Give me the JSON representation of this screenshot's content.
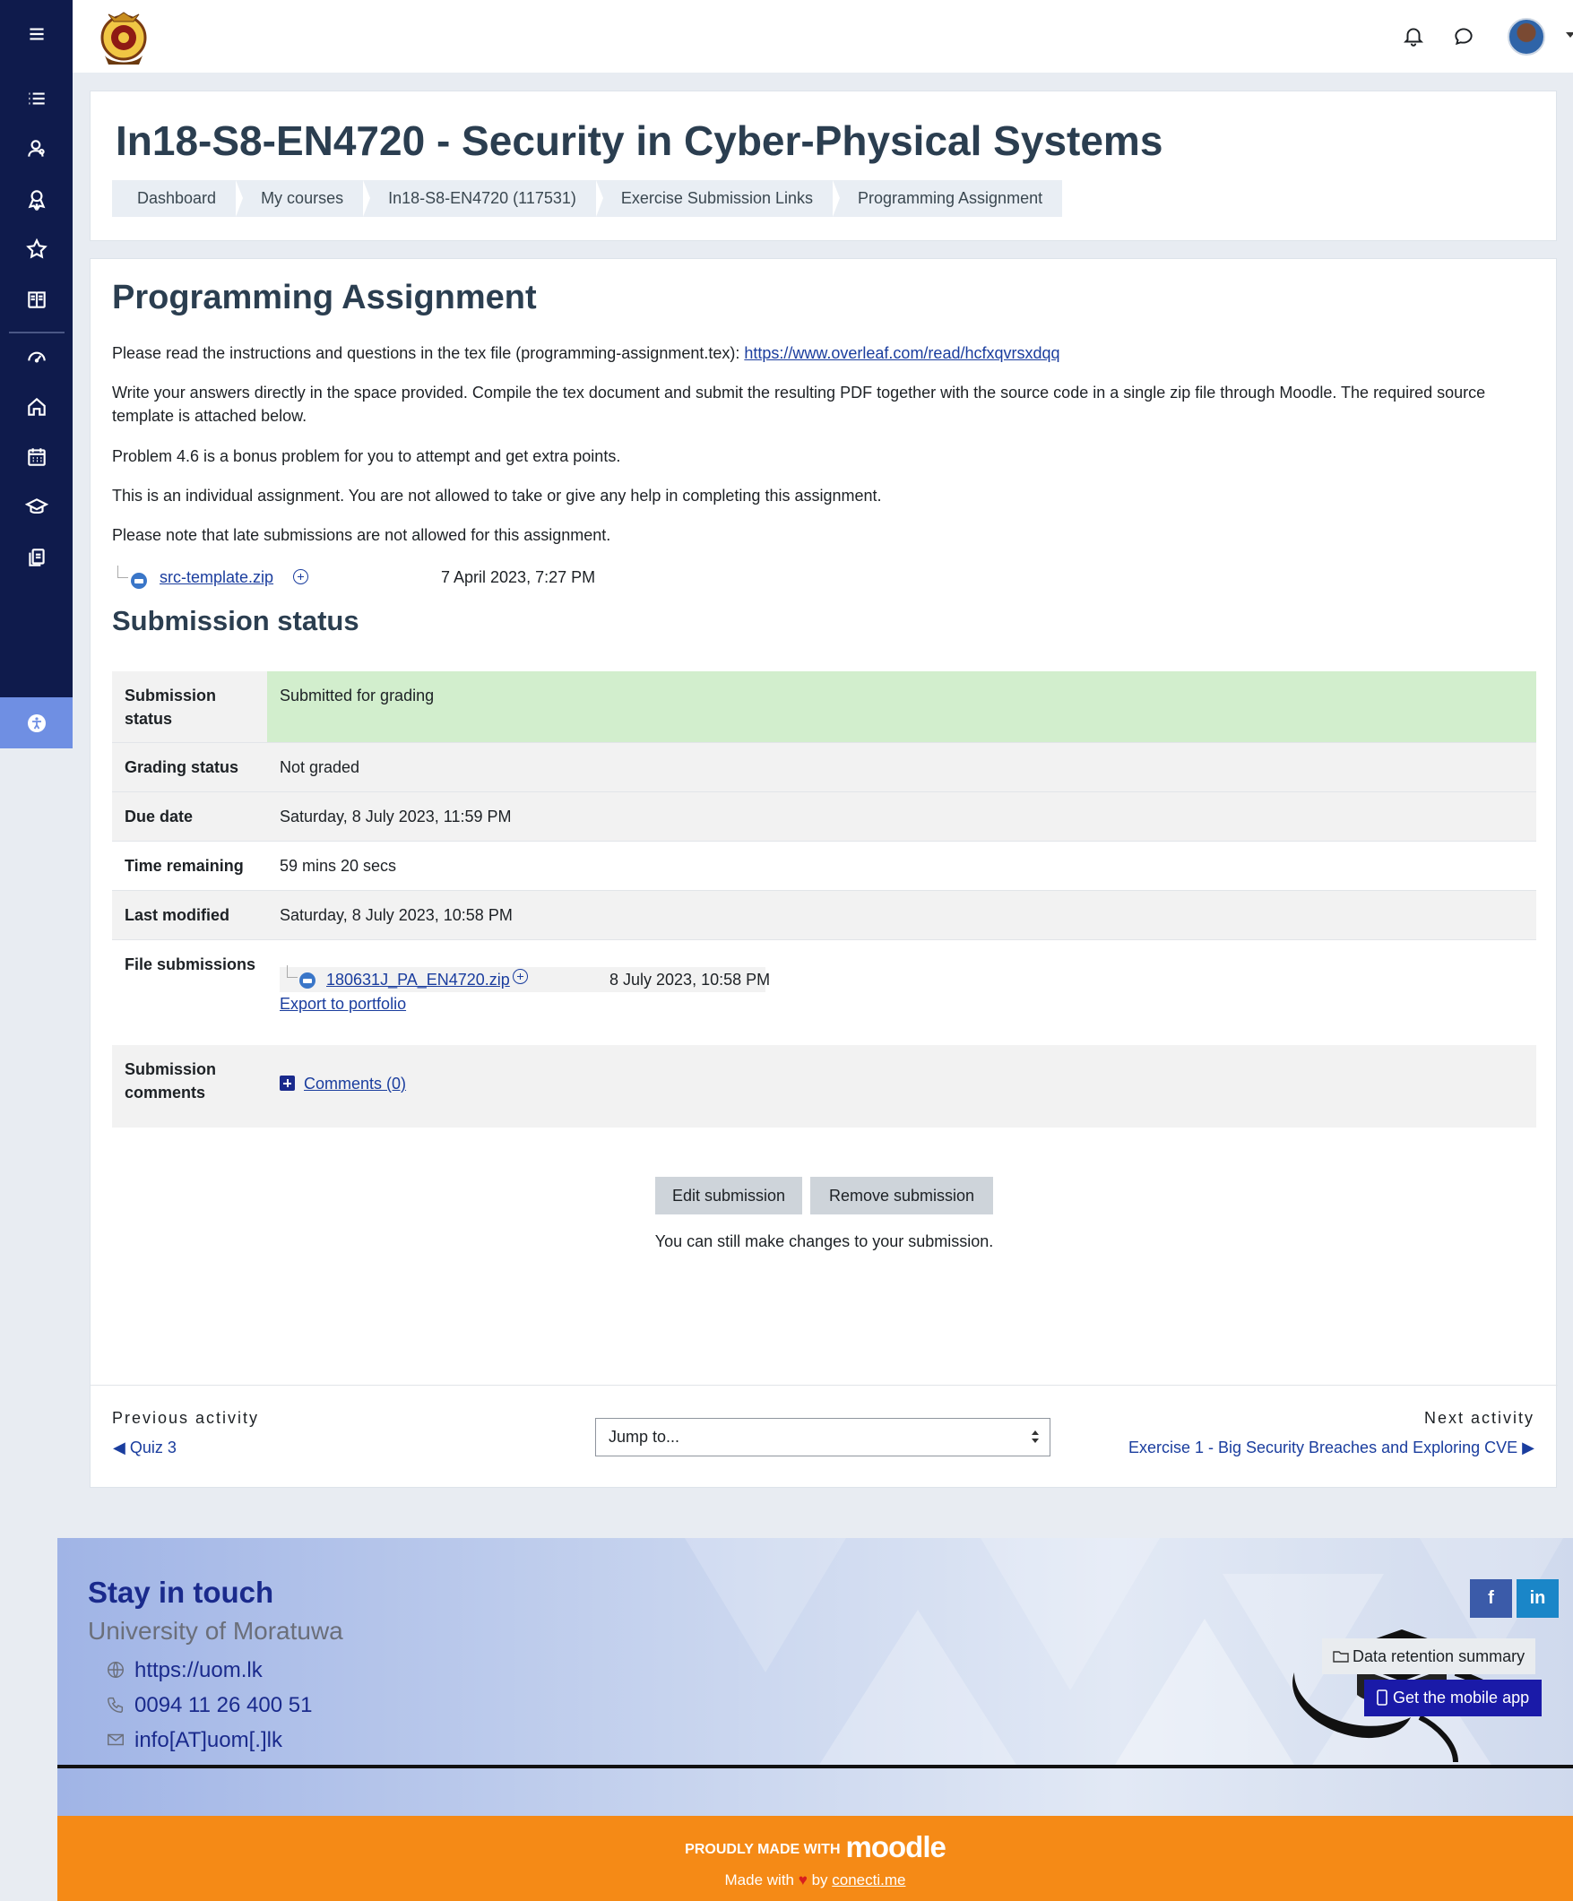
{
  "header": {
    "course_title": "In18-S8-EN4720 - Security in Cyber-Physical Systems",
    "breadcrumbs": [
      "Dashboard",
      "My courses",
      "In18-S8-EN4720 (117531)",
      "Exercise Submission Links",
      "Programming Assignment"
    ]
  },
  "activity": {
    "title": "Programming Assignment",
    "intro_text": "Please read the instructions and questions in the tex file (programming-assignment.tex): ",
    "intro_link": "https://www.overleaf.com/read/hcfxqvrsxdqq",
    "para2": "Write your answers directly in the space provided. Compile the tex document and submit the resulting PDF together with the source code in a single zip file through Moodle. The required source template is attached below.",
    "para3": "Problem 4.6 is a bonus problem for you to attempt and get extra points.",
    "para4": "This is an individual assignment. You are not allowed to take or give any help in completing this assignment.",
    "para5": "Please note that late submissions are not allowed for this assignment.",
    "attachment_name": "src-template.zip",
    "attachment_date": "7 April 2023, 7:27 PM"
  },
  "submission": {
    "heading": "Submission status",
    "rows": [
      {
        "label": "Submission status",
        "value": "Submitted for grading"
      },
      {
        "label": "Grading status",
        "value": "Not graded"
      },
      {
        "label": "Due date",
        "value": "Saturday, 8 July 2023, 11:59 PM"
      },
      {
        "label": "Time remaining",
        "value": "59 mins 20 secs"
      },
      {
        "label": "Last modified",
        "value": "Saturday, 8 July 2023, 10:58 PM"
      },
      {
        "label": "File submissions",
        "value": ""
      },
      {
        "label": "Submission comments",
        "value": ""
      }
    ],
    "file_name": "180631J_PA_EN4720.zip",
    "file_date": "8 July 2023, 10:58 PM",
    "export_link": "Export to portfolio",
    "comments_link": "Comments (0)",
    "edit_button": "Edit submission",
    "remove_button": "Remove submission",
    "changes_note": "You can still make changes to your submission."
  },
  "activity_nav": {
    "previous_caption": "Previous activity",
    "previous_link": "◀ Quiz 3",
    "jump_placeholder": "Jump to...",
    "next_caption": "Next activity",
    "next_link": "Exercise 1 - Big Security Breaches and Exploring CVE ▶"
  },
  "footer": {
    "stay_title": "Stay in touch",
    "university": "University of Moratuwa",
    "website": "https://uom.lk",
    "phone": "0094 11 26 400 51",
    "email": "info[AT]uom[.]lk",
    "data_retention": "Data retention summary",
    "mobile_app": "Get the mobile app",
    "proudly": "PROUDLY MADE WITH",
    "moodle": "moodle",
    "made_with": "Made with",
    "by": "by",
    "conecti": "conecti.me"
  },
  "colors": {
    "sidebar": "#0f1b4c",
    "accent_link": "#1a3d9e",
    "submitted_green": "#d2eecd",
    "footer_orange": "#f58a16",
    "mobile_button": "#1a1aa8"
  },
  "icons": {
    "sidebar": [
      "hamburger-icon",
      "list-icon",
      "participants-icon",
      "badge-icon",
      "star-icon",
      "book-icon",
      "dashboard-gauge-icon",
      "home-icon",
      "calendar-icon",
      "graduation-cap-icon",
      "files-icon",
      "accessibility-icon"
    ],
    "topbar": [
      "bell-icon",
      "chat-icon"
    ]
  }
}
